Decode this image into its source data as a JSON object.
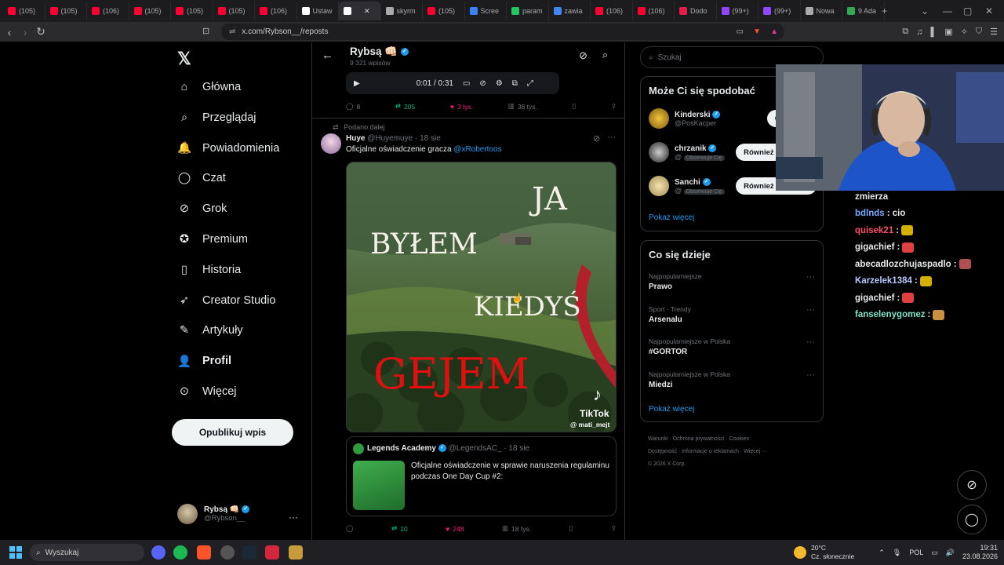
{
  "browser": {
    "tabs": [
      {
        "label": "(105)",
        "color": "#ff0033"
      },
      {
        "label": "(105)",
        "color": "#ff0033"
      },
      {
        "label": "(106)",
        "color": "#ff0033"
      },
      {
        "label": "(105)",
        "color": "#ff0033"
      },
      {
        "label": "(105)",
        "color": "#ff0033"
      },
      {
        "label": "(105)",
        "color": "#ff0033"
      },
      {
        "label": "(106)",
        "color": "#ff0033"
      },
      {
        "label": "Ustaw",
        "color": "#ffffff"
      },
      {
        "label": "",
        "color": "#ffffff",
        "active": true
      },
      {
        "label": "skyrm",
        "color": "#aaaaaa"
      },
      {
        "label": "(105)",
        "color": "#ff0033"
      },
      {
        "label": "Scree",
        "color": "#3b82f6"
      },
      {
        "label": "param",
        "color": "#22c55e"
      },
      {
        "label": "zawia",
        "color": "#4285f4"
      },
      {
        "label": "(106)",
        "color": "#ff0033"
      },
      {
        "label": "(106)",
        "color": "#ff0033"
      },
      {
        "label": "Dodo",
        "color": "#e11d48"
      },
      {
        "label": "(99+)",
        "color": "#9146ff"
      },
      {
        "label": "(99+)",
        "color": "#9146ff"
      },
      {
        "label": "Nowa",
        "color": "#aaaaaa"
      },
      {
        "label": "9 Ada",
        "color": "#34a853"
      }
    ],
    "url": "x.com/Rybson__/reposts"
  },
  "nav": {
    "items": [
      {
        "label": "Główna",
        "icon": "home-icon"
      },
      {
        "label": "Przeglądaj",
        "icon": "search-icon"
      },
      {
        "label": "Powiadomienia",
        "icon": "bell-icon"
      },
      {
        "label": "Czat",
        "icon": "chat-icon"
      },
      {
        "label": "Grok",
        "icon": "grok-icon"
      },
      {
        "label": "Premium",
        "icon": "premium-icon"
      },
      {
        "label": "Historia",
        "icon": "bookmark-icon"
      },
      {
        "label": "Creator Studio",
        "icon": "rocket-icon"
      },
      {
        "label": "Artykuły",
        "icon": "article-icon"
      },
      {
        "label": "Profil",
        "icon": "profile-icon"
      },
      {
        "label": "Więcej",
        "icon": "more-icon"
      }
    ],
    "post_button": "Opublikuj wpis",
    "account": {
      "name": "Rybsą",
      "handle": "@Rybson__"
    }
  },
  "profile_header": {
    "name": "Rybsą",
    "posts": "9 321 wpisów"
  },
  "video": {
    "time": "0:01 / 0:31"
  },
  "post1_actions": {
    "replies": "8",
    "reposts": "205",
    "likes": "3 tys.",
    "views": "38 tys."
  },
  "post2": {
    "repost_label": "Podano dalej",
    "author": "Huye",
    "handle": "@Huyemuye",
    "date": "· 18 sie",
    "text": "Oficjalne oświadczenie gracza",
    "mention": "@xRobertoos",
    "media_words": [
      "JA",
      "BYŁEM",
      "KIEDYŚ",
      "GEJEM"
    ],
    "tiktok_label": "TikTok",
    "tiktok_user": "@ mati_mejt",
    "quote": {
      "author": "Legends Academy",
      "handle": "@LegendsAC_",
      "date": "· 18 sie",
      "text": "Oficjalne oświadczenie w sprawie naruszenia regulaminu podczas One Day Cup #2:"
    },
    "actions": {
      "reposts": "10",
      "likes": "248",
      "views": "18 tys."
    }
  },
  "sidebar": {
    "search_placeholder": "Szukaj",
    "who_title": "Może Ci się spodobać",
    "suggestions": [
      {
        "name": "Kinderski",
        "handle": "@PosKacper",
        "badge": "",
        "button": "Obserwuj"
      },
      {
        "name": "chrzanik",
        "handle": "@",
        "badge": "Obserwuje Cię",
        "button": "Również obserwuj"
      },
      {
        "name": "Sanchi",
        "handle": "@",
        "badge": "Obserwuje Cię",
        "button": "Również obserwuj"
      }
    ],
    "show_more": "Pokaż więcej",
    "trends_title": "Co się dzieje",
    "trends": [
      {
        "category": "Najpopularniejsze",
        "topic": "Prawo"
      },
      {
        "category": "Sport · Trendy",
        "topic": "Arsenalu"
      },
      {
        "category": "Najpopularniejsze w Polska",
        "topic": "#GORTOR"
      },
      {
        "category": "Najpopularniejsze w Polska",
        "topic": "Miedzi"
      }
    ],
    "trends_more": "Pokaż więcej",
    "footer": [
      "Warunki",
      "Ochrona prywatności",
      "Cookies",
      "Dostępność",
      "Informacje o reklamach",
      "Więcej ···",
      "© 2026 X Corp."
    ]
  },
  "stream_chat": [
    {
      "user": "zmierza",
      "color": "#e7e9ea",
      "msg": ""
    },
    {
      "user": "bdlnds",
      "color": "#7aa7ff",
      "msg": ": cio"
    },
    {
      "user": "quisek21",
      "color": "#ff4d6d",
      "msg": ":"
    },
    {
      "user": "gigachief",
      "color": "#e7e9ea",
      "msg": ":"
    },
    {
      "user": "abecadlozchujaspadlo",
      "color": "#e7e9ea",
      "msg": ":"
    },
    {
      "user": "Karzelek1384",
      "color": "#b9c7ff",
      "msg": ":"
    },
    {
      "user": "gigachief",
      "color": "#e7e9ea",
      "msg": ":"
    },
    {
      "user": "fanselenygomez",
      "color": "#7fe3c5",
      "msg": ":"
    }
  ],
  "taskbar": {
    "search": "Wyszukaj",
    "weather_temp": "20°C",
    "weather_desc": "Cz. słonecznie",
    "lang": "POL",
    "time": "19:31",
    "date": "23.08.2026"
  }
}
